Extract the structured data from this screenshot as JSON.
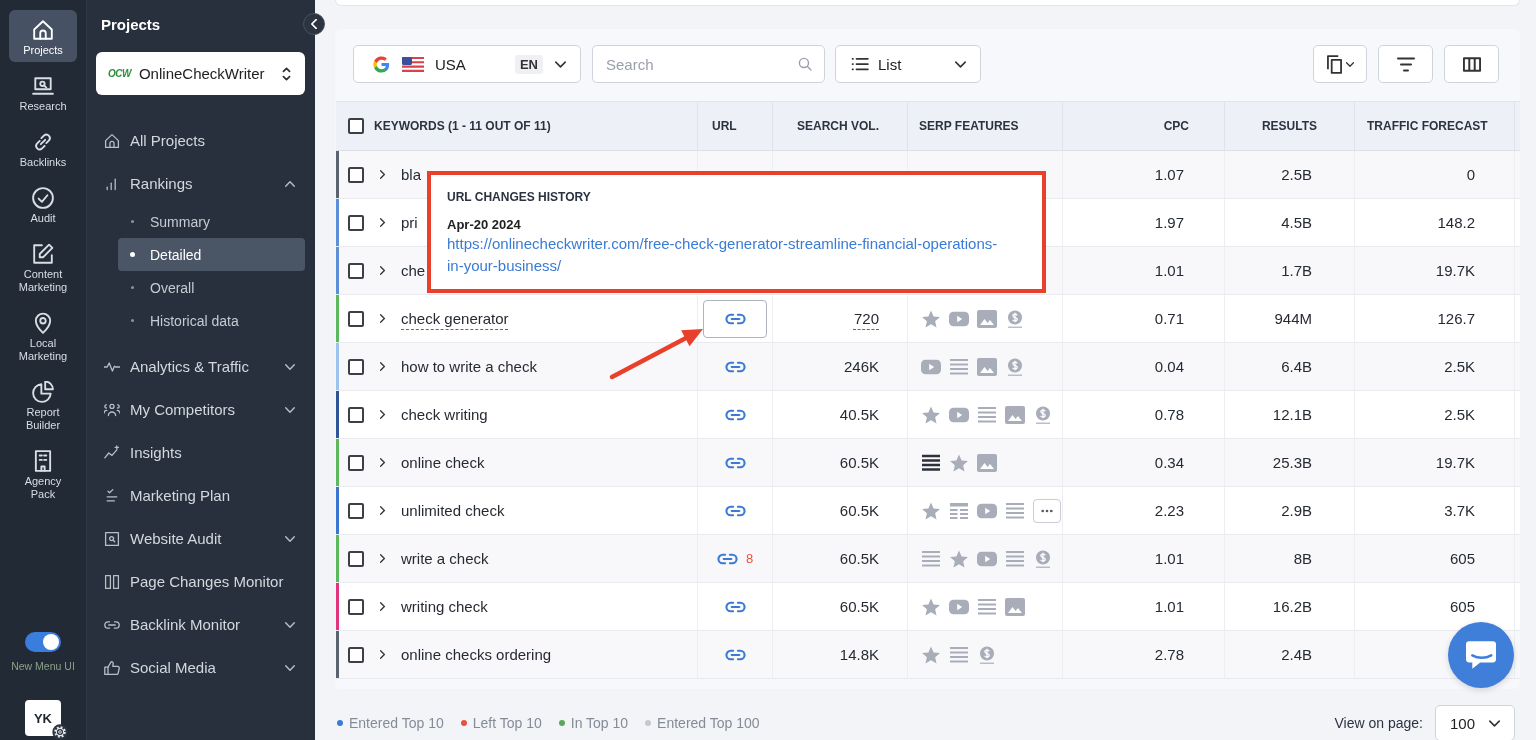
{
  "rail": {
    "items": [
      {
        "label": "Projects",
        "selected": true
      },
      {
        "label": "Research",
        "selected": false
      },
      {
        "label": "Backlinks",
        "selected": false
      },
      {
        "label": "Audit",
        "selected": false
      },
      {
        "label": "Content Marketing",
        "selected": false
      },
      {
        "label": "Local Marketing",
        "selected": false
      },
      {
        "label": "Report Builder",
        "selected": false
      },
      {
        "label": "Agency Pack",
        "selected": false
      }
    ],
    "toggle": {
      "label": "New Menu UI",
      "on": true
    },
    "avatar": {
      "initials": "YK"
    }
  },
  "sidebar": {
    "title": "Projects",
    "project": {
      "logo": "OCW",
      "name": "OnlineCheckWriter"
    },
    "items": [
      {
        "kind": "link",
        "label": "All Projects"
      },
      {
        "kind": "group",
        "label": "Rankings",
        "expanded": true,
        "children": [
          {
            "label": "Summary",
            "selected": false
          },
          {
            "label": "Detailed",
            "selected": true
          },
          {
            "label": "Overall",
            "selected": false
          },
          {
            "label": "Historical data",
            "selected": false
          }
        ]
      },
      {
        "kind": "group",
        "label": "Analytics & Traffic",
        "expanded": false
      },
      {
        "kind": "group",
        "label": "My Competitors",
        "expanded": false
      },
      {
        "kind": "link",
        "label": "Insights"
      },
      {
        "kind": "link",
        "label": "Marketing Plan"
      },
      {
        "kind": "group",
        "label": "Website Audit",
        "expanded": false
      },
      {
        "kind": "link",
        "label": "Page Changes Monitor"
      },
      {
        "kind": "group",
        "label": "Backlink Monitor",
        "expanded": false
      },
      {
        "kind": "group",
        "label": "Social Media",
        "expanded": false
      }
    ]
  },
  "toolbar": {
    "engine": {
      "country": "USA",
      "language": "EN"
    },
    "search": {
      "placeholder": "Search"
    },
    "view": {
      "label": "List"
    }
  },
  "table": {
    "select_all": {
      "checked": false
    },
    "columns": [
      "KEYWORDS (1 - 11 OUT OF 11)",
      "URL",
      "SEARCH VOL.",
      "SERP FEATURES",
      "CPC",
      "RESULTS",
      "TRAFFIC FORECAST"
    ],
    "rows": [
      {
        "keyword": "bla",
        "color": "#5b6270",
        "checked": false,
        "expanded": false,
        "hovered": false,
        "link": false,
        "cpc": "1.07",
        "results": "2.5B",
        "traffic": "0"
      },
      {
        "keyword": "pri",
        "color": "#5b8fd8",
        "checked": false,
        "expanded": false,
        "hovered": false,
        "link": false,
        "cpc": "1.97",
        "results": "4.5B",
        "traffic": "148.2"
      },
      {
        "keyword": "che",
        "color": "#5b8fd8",
        "checked": false,
        "expanded": false,
        "hovered": false,
        "link": false,
        "cpc": "1.01",
        "results": "1.7B",
        "traffic": "19.7K"
      },
      {
        "keyword": "check generator",
        "color": "#5cb85c",
        "checked": false,
        "expanded": false,
        "hovered": true,
        "link": true,
        "volume": "720",
        "serp": [
          {
            "kind": "star",
            "highlighted": false
          },
          {
            "kind": "video",
            "highlighted": false
          },
          {
            "kind": "image",
            "highlighted": false
          },
          {
            "kind": "dollar",
            "highlighted": false
          }
        ],
        "cpc": "0.71",
        "results": "944M",
        "traffic": "126.7"
      },
      {
        "keyword": "how to write a check",
        "color": "#9cc3ee",
        "checked": false,
        "expanded": false,
        "hovered": false,
        "link": true,
        "volume": "246K",
        "serp": [
          {
            "kind": "video",
            "highlighted": false
          },
          {
            "kind": "list",
            "highlighted": false
          },
          {
            "kind": "image",
            "highlighted": false
          },
          {
            "kind": "dollar",
            "highlighted": false
          }
        ],
        "cpc": "0.04",
        "results": "6.4B",
        "traffic": "2.5K"
      },
      {
        "keyword": "check writing",
        "color": "#2f5597",
        "checked": false,
        "expanded": false,
        "hovered": false,
        "link": true,
        "volume": "40.5K",
        "serp": [
          {
            "kind": "star",
            "highlighted": false
          },
          {
            "kind": "video",
            "highlighted": false
          },
          {
            "kind": "list",
            "highlighted": false
          },
          {
            "kind": "image",
            "highlighted": false
          },
          {
            "kind": "dollar",
            "highlighted": false
          }
        ],
        "cpc": "0.78",
        "results": "12.1B",
        "traffic": "2.5K"
      },
      {
        "keyword": "online check",
        "color": "#5cb85c",
        "checked": false,
        "expanded": false,
        "hovered": false,
        "link": true,
        "volume": "60.5K",
        "serp": [
          {
            "kind": "list",
            "highlighted": true
          },
          {
            "kind": "star",
            "highlighted": false
          },
          {
            "kind": "image",
            "highlighted": false
          }
        ],
        "cpc": "0.34",
        "results": "25.3B",
        "traffic": "19.7K"
      },
      {
        "keyword": "unlimited check",
        "color": "#3a76d0",
        "checked": false,
        "expanded": false,
        "hovered": false,
        "link": true,
        "volume": "60.5K",
        "serp": [
          {
            "kind": "star",
            "highlighted": false
          },
          {
            "kind": "table",
            "highlighted": false
          },
          {
            "kind": "video",
            "highlighted": false
          },
          {
            "kind": "list",
            "highlighted": false
          },
          {
            "kind": "more",
            "highlighted": false
          }
        ],
        "cpc": "2.23",
        "results": "2.9B",
        "traffic": "3.7K"
      },
      {
        "keyword": "write a check",
        "color": "#5cb85c",
        "checked": false,
        "expanded": false,
        "hovered": false,
        "link": true,
        "url_changes": "8",
        "volume": "60.5K",
        "serp": [
          {
            "kind": "list",
            "highlighted": false
          },
          {
            "kind": "star",
            "highlighted": false
          },
          {
            "kind": "video",
            "highlighted": false
          },
          {
            "kind": "list",
            "highlighted": false
          },
          {
            "kind": "dollar",
            "highlighted": false
          }
        ],
        "cpc": "1.01",
        "results": "8B",
        "traffic": "605"
      },
      {
        "keyword": "writing check",
        "color": "#e0357d",
        "checked": false,
        "expanded": false,
        "hovered": false,
        "link": true,
        "volume": "60.5K",
        "serp": [
          {
            "kind": "star",
            "highlighted": false
          },
          {
            "kind": "video",
            "highlighted": false
          },
          {
            "kind": "list",
            "highlighted": false
          },
          {
            "kind": "image",
            "highlighted": false
          }
        ],
        "cpc": "1.01",
        "results": "16.2B",
        "traffic": "605"
      },
      {
        "keyword": "online checks ordering",
        "color": "#5b6270",
        "checked": false,
        "expanded": false,
        "hovered": false,
        "link": true,
        "volume": "14.8K",
        "serp": [
          {
            "kind": "star",
            "highlighted": false
          },
          {
            "kind": "list",
            "highlighted": false
          },
          {
            "kind": "dollar",
            "highlighted": false
          }
        ],
        "cpc": "2.78",
        "results": "2.4B"
      }
    ]
  },
  "tooltip": {
    "title": "URL CHANGES HISTORY",
    "date": "Apr-20 2024",
    "url": "https://onlinecheckwriter.com/free-check-generator-streamline-financial-operations-in-your-business/"
  },
  "legend": [
    {
      "label": "Entered Top 10",
      "color": "#3a7bd5"
    },
    {
      "label": "Left Top 10",
      "color": "#e5533d"
    },
    {
      "label": "In Top 10",
      "color": "#5aa65a"
    },
    {
      "label": "Entered Top 100",
      "color": "#c5c8cf"
    }
  ],
  "pagination": {
    "label": "View on page:",
    "value": "100"
  }
}
